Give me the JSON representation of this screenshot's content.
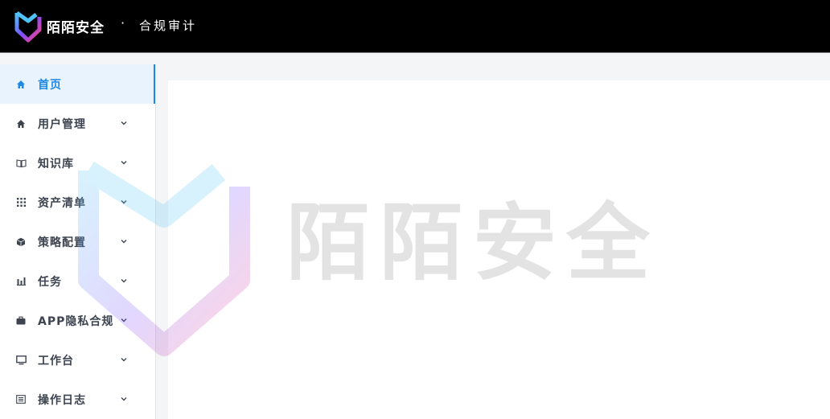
{
  "header": {
    "brand": "陌陌安全",
    "separator": "·",
    "module": "合规审计"
  },
  "sidebar": {
    "items": [
      {
        "label": "首页",
        "icon": "home-icon",
        "active": true,
        "expandable": false
      },
      {
        "label": "用户管理",
        "icon": "home-icon",
        "active": false,
        "expandable": true
      },
      {
        "label": "知识库",
        "icon": "book-icon",
        "active": false,
        "expandable": true
      },
      {
        "label": "资产清单",
        "icon": "grid-icon",
        "active": false,
        "expandable": true
      },
      {
        "label": "策略配置",
        "icon": "cube-icon",
        "active": false,
        "expandable": true
      },
      {
        "label": "任务",
        "icon": "bar-chart-icon",
        "active": false,
        "expandable": true
      },
      {
        "label": "APP隐私合规",
        "icon": "briefcase-icon",
        "active": false,
        "expandable": true
      },
      {
        "label": "工作台",
        "icon": "monitor-icon",
        "active": false,
        "expandable": true
      },
      {
        "label": "操作日志",
        "icon": "log-icon",
        "active": false,
        "expandable": true
      }
    ]
  },
  "watermark": {
    "text": "陌陌安全"
  },
  "colors": {
    "accent": "#1e88e5",
    "active_bg": "#e8f3fd",
    "topbar": "#000000"
  }
}
